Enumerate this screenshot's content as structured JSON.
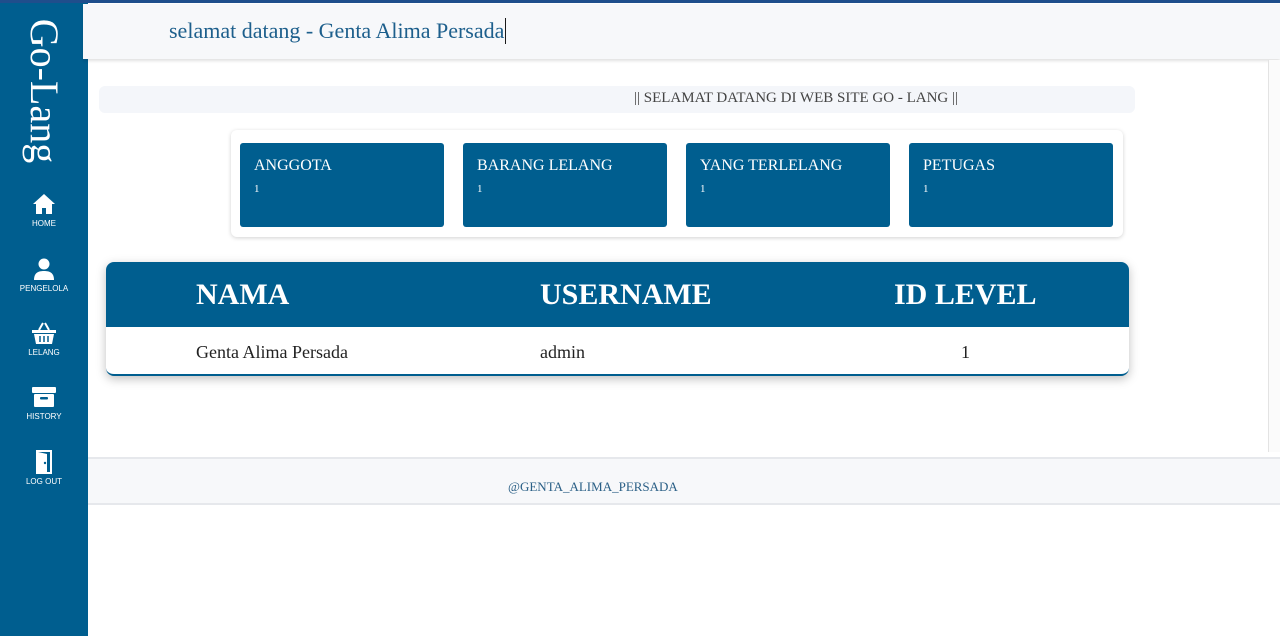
{
  "app": {
    "brand": "Go-Lang",
    "accent_color": "#005e8f"
  },
  "header": {
    "title": "selamat datang - Genta Alima Persada"
  },
  "sidebar": {
    "items": [
      {
        "label": "HOME",
        "icon": "home-icon"
      },
      {
        "label": "PENGELOLA",
        "icon": "user-icon"
      },
      {
        "label": "LELANG",
        "icon": "basket-icon"
      },
      {
        "label": "HISTORY",
        "icon": "archive-icon"
      },
      {
        "label": "LOG OUT",
        "icon": "door-exit-icon"
      }
    ]
  },
  "welcome": {
    "text": "|| SELAMAT DATANG DI WEB SITE GO - LANG ||"
  },
  "cards": [
    {
      "title": "ANGGOTA",
      "value": "1"
    },
    {
      "title": "BARANG LELANG",
      "value": "1"
    },
    {
      "title": "YANG TERLELANG",
      "value": "1"
    },
    {
      "title": "PETUGAS",
      "value": "1"
    }
  ],
  "table": {
    "headers": [
      "NAMA",
      "USERNAME",
      "ID LEVEL"
    ],
    "rows": [
      [
        "Genta Alima Persada",
        "admin",
        "1"
      ]
    ]
  },
  "footer": {
    "text": "@GENTA_ALIMA_PERSADA"
  }
}
